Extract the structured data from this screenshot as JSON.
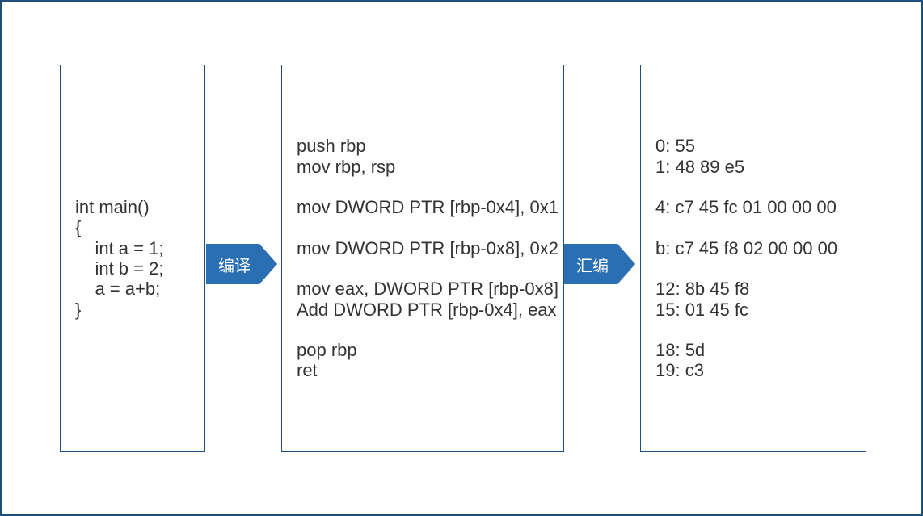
{
  "panels": {
    "source": "int main()\n{\n    int a = 1;\n    int b = 2;\n    a = a+b;\n}",
    "assembly": "push rbp\nmov rbp, rsp\n\nmov DWORD PTR [rbp-0x4], 0x1\n\nmov DWORD PTR [rbp-0x8], 0x2\n\nmov eax, DWORD PTR [rbp-0x8]\nAdd DWORD PTR [rbp-0x4], eax\n\npop rbp\nret",
    "machine_code": "0: 55\n1: 48 89 e5\n\n4: c7 45 fc 01 00 00 00\n\nb: c7 45 f8 02 00 00 00\n\n12: 8b 45 f8\n15: 01 45 fc\n\n18: 5d\n19: c3"
  },
  "arrows": {
    "compile_label": "编译",
    "assemble_label": "汇编"
  },
  "colors": {
    "border": "#1f4e79",
    "arrow_fill": "#2b6fb3",
    "text": "#333333"
  }
}
